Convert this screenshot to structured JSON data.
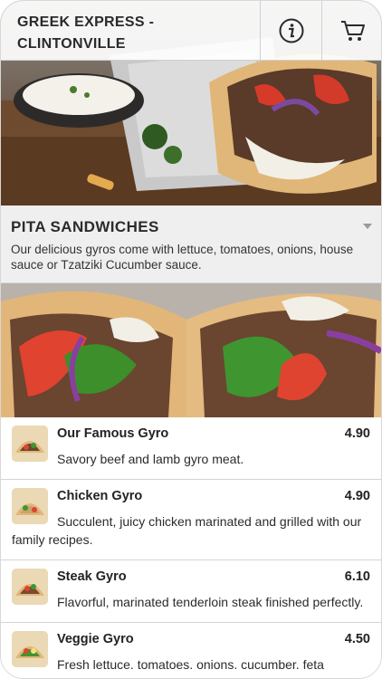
{
  "header": {
    "title": "GREEK EXPRESS -\nCLINTONVILLE",
    "info_icon": "info-icon",
    "cart_icon": "cart-icon"
  },
  "category": {
    "title": "PITA SANDWICHES",
    "description": "Our delicious gyros come with lettuce, tomatoes, onions, house sauce or Tzatziki Cucumber sauce."
  },
  "items": [
    {
      "name": "Our Famous Gyro",
      "price": "4.90",
      "description": "Savory beef and lamb gyro meat."
    },
    {
      "name": "Chicken Gyro",
      "price": "4.90",
      "description": "Succulent, juicy chicken marinated and grilled with our family recipes."
    },
    {
      "name": "Steak Gyro",
      "price": "6.10",
      "description": "Flavorful, marinated tenderloin steak finished perfectly."
    },
    {
      "name": "Veggie Gyro",
      "price": "4.50",
      "description": "Fresh lettuce, tomatoes, onions, cucumber, feta"
    }
  ],
  "colors": {
    "header_bg": "#ffffff",
    "category_bg": "#efefef",
    "text": "#222222"
  }
}
